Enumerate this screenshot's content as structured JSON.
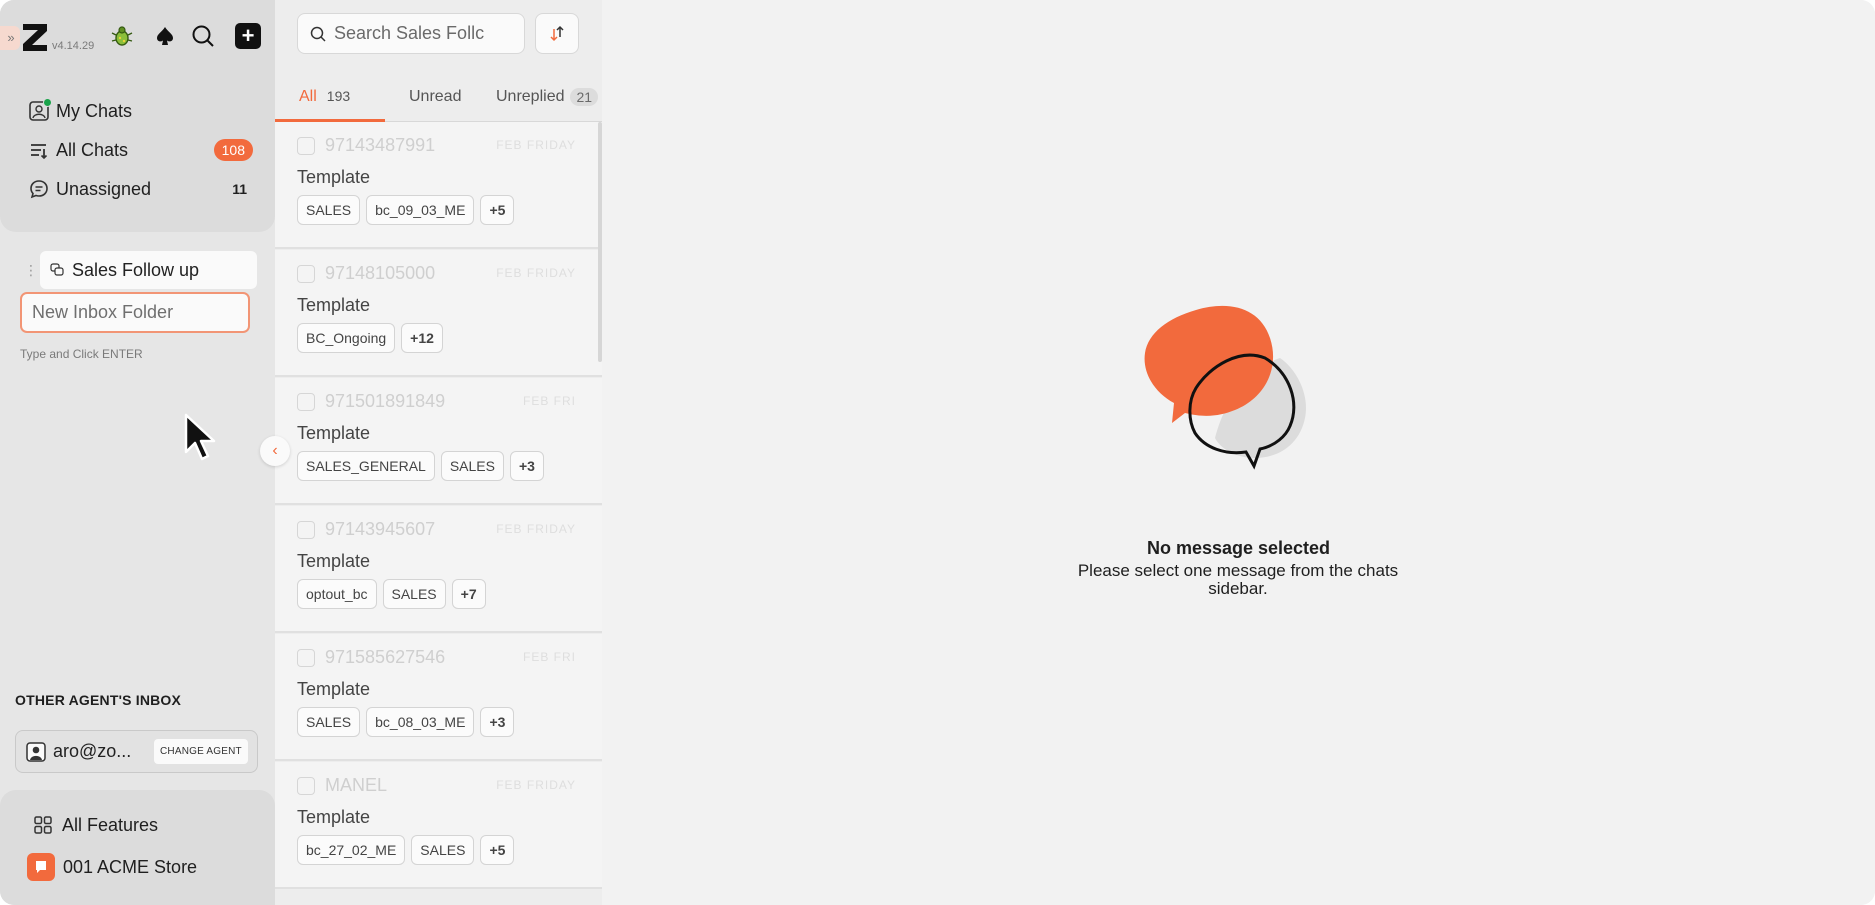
{
  "app": {
    "version": "v4.14.29",
    "accent_color": "#f26a3d",
    "expand_glyph": "»"
  },
  "sidebar": {
    "nav": [
      {
        "label": "My Chats",
        "icon": "user-chat-icon",
        "count": ""
      },
      {
        "label": "All Chats",
        "icon": "list-filter-icon",
        "count": "108"
      },
      {
        "label": "Unassigned",
        "icon": "chat-bubble-icon",
        "count": "11"
      }
    ],
    "folder": {
      "label": "Sales Follow up"
    },
    "new_folder_placeholder": "New Inbox Folder",
    "hint": "Type and Click ENTER",
    "other_agents_title": "OTHER AGENT'S INBOX",
    "agent": {
      "name": "aro@zo...",
      "change_label": "CHANGE AGENT"
    },
    "bottom": [
      {
        "label": "All Features",
        "icon": "grid-icon"
      },
      {
        "label": "001 ACME Store",
        "icon": "store-icon"
      }
    ]
  },
  "chatlist": {
    "search_placeholder": "Search Sales Follc",
    "tabs": [
      {
        "label": "All",
        "count": "193",
        "active": true
      },
      {
        "label": "Unread",
        "count": "",
        "active": false
      },
      {
        "label": "Unreplied",
        "count": "21",
        "active": false
      }
    ],
    "items": [
      {
        "phone": "97143487991",
        "time": "FEB FRIDAY",
        "preview": "Template",
        "tags": [
          "SALES",
          "bc_09_03_ME",
          "+5"
        ]
      },
      {
        "phone": "97148105000",
        "time": "FEB FRIDAY",
        "preview": "Template",
        "tags": [
          "BC_Ongoing",
          "+12"
        ]
      },
      {
        "phone": "971501891849",
        "time": "FEB FRI",
        "preview": "Template",
        "tags": [
          "SALES_GENERAL",
          "SALES",
          "+3"
        ]
      },
      {
        "phone": "97143945607",
        "time": "FEB FRIDAY",
        "preview": "Template",
        "tags": [
          "optout_bc",
          "SALES",
          "+7"
        ]
      },
      {
        "phone": "971585627546",
        "time": "FEB FRI",
        "preview": "Template",
        "tags": [
          "SALES",
          "bc_08_03_ME",
          "+3"
        ]
      },
      {
        "phone": "MANEL",
        "time": "FEB FRIDAY",
        "preview": "Template",
        "tags": [
          "bc_27_02_ME",
          "SALES",
          "+5"
        ]
      }
    ]
  },
  "main": {
    "empty_title": "No message selected",
    "empty_desc": "Please select one message from the chats sidebar."
  }
}
